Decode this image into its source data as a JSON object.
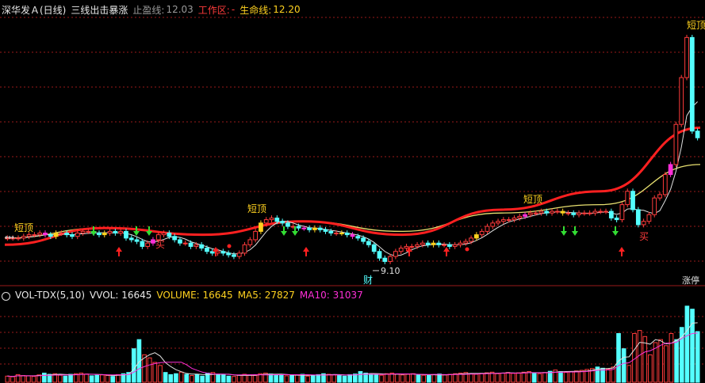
{
  "header": {
    "stock": "深华发Ａ(日线)",
    "indicator": "三线出击暴涨",
    "stop_label": "止盈线:",
    "stop_value": "12.03",
    "work_label": "工作区:",
    "work_value": "-",
    "life_label": "生命线:",
    "life_value": "12.20"
  },
  "vol_header": {
    "name": "VOL-TDX(5,10)",
    "vvol": "VVOL: 16645",
    "volume": "VOLUME: 16645",
    "ma5": "MA5: 27827",
    "ma10": "MA10: 31037"
  },
  "colors": {
    "up": "#ff3b3b",
    "down": "#54ffff",
    "red_line": "#ff2020",
    "yellow_line": "#e8e070",
    "white_line": "#e0e0e0",
    "yellow_candle": "#ffd21f",
    "magenta_candle": "#ff2fd8",
    "green_arrow": "#33dd33",
    "red_arrow": "#ff2020",
    "grid": "#9a1a1a",
    "short_top_label": "#ffd21f",
    "cai_label": "#54ffff",
    "mai_label": "#ff3b3b"
  },
  "chart_data": {
    "type": "candlestick",
    "y_range_price": [
      7.6,
      15.6
    ],
    "price_series_close": [
      9.0,
      9.0,
      9.0,
      9.05,
      9.1,
      9.1,
      9.15,
      9.1,
      9.05,
      9.15,
      9.15,
      9.1,
      9.05,
      9.15,
      9.2,
      9.2,
      9.15,
      9.1,
      9.15,
      9.2,
      9.15,
      9.2,
      9.0,
      8.95,
      8.9,
      8.75,
      8.85,
      8.95,
      9.1,
      9.15,
      9.05,
      8.95,
      8.85,
      8.85,
      8.75,
      8.8,
      8.7,
      8.6,
      8.55,
      8.6,
      8.55,
      8.5,
      8.45,
      8.55,
      8.8,
      8.95,
      9.2,
      9.45,
      9.55,
      9.6,
      9.5,
      9.45,
      9.35,
      9.35,
      9.3,
      9.3,
      9.25,
      9.3,
      9.25,
      9.2,
      9.15,
      9.15,
      9.15,
      9.1,
      9.05,
      9.0,
      8.9,
      8.8,
      8.6,
      8.4,
      8.3,
      8.45,
      8.6,
      8.7,
      8.75,
      8.75,
      8.8,
      8.85,
      8.8,
      8.85,
      8.8,
      8.8,
      8.75,
      8.8,
      8.85,
      8.9,
      9.0,
      9.1,
      9.2,
      9.35,
      9.45,
      9.5,
      9.55,
      9.55,
      9.6,
      9.65,
      9.7,
      9.75,
      9.75,
      9.8,
      9.75,
      9.8,
      9.8,
      9.75,
      9.75,
      9.7,
      9.75,
      9.75,
      9.75,
      9.8,
      9.8,
      9.8,
      9.6,
      9.55,
      10.0,
      10.4,
      9.85,
      9.4,
      9.5,
      9.7,
      10.2,
      10.3,
      10.9,
      11.2,
      12.4,
      13.8,
      15.0,
      12.2,
      12.0
    ],
    "red_line_y": [
      8.8,
      9.3,
      9.1,
      9.5,
      9.1,
      9.85,
      10.4,
      12.3
    ],
    "yellow_line_y": [
      9.0,
      9.3,
      9.1,
      9.5,
      9.2,
      9.75,
      10.0,
      11.2
    ],
    "signals": {
      "short_top": "短顶",
      "cai": "财",
      "mai": "买",
      "low_label": "9.10",
      "corner": "涨停"
    },
    "volume": [
      2000,
      1800,
      2500,
      2200,
      2100,
      1900,
      2400,
      3000,
      2600,
      2800,
      2300,
      2000,
      2600,
      2800,
      3000,
      2700,
      2100,
      2300,
      2400,
      2200,
      1900,
      2500,
      2800,
      3200,
      11000,
      14000,
      9000,
      8000,
      6500,
      5500,
      3200,
      2500,
      2800,
      3300,
      2600,
      2200,
      2500,
      2000,
      3000,
      3200,
      2600,
      2400,
      2000,
      1900,
      2300,
      2600,
      2400,
      2200,
      2800,
      3000,
      2700,
      2500,
      2300,
      2100,
      2200,
      2400,
      2600,
      2000,
      2300,
      2500,
      2800,
      2600,
      2400,
      2200,
      2000,
      2500,
      2700,
      3500,
      3000,
      2600,
      2400,
      2300,
      2800,
      3000,
      2700,
      2400,
      2600,
      2800,
      2400,
      2300,
      2200,
      2500,
      2700,
      2400,
      2600,
      2800,
      3000,
      3200,
      2800,
      2600,
      2900,
      3100,
      3300,
      2800,
      3000,
      3200,
      2900,
      3100,
      3300,
      3500,
      3000,
      2800,
      3200,
      3600,
      4000,
      3500,
      3200,
      3400,
      3700,
      3900,
      4200,
      4500,
      5000,
      4600,
      4300,
      5000,
      16000,
      11000,
      5500,
      16000,
      17000,
      15000,
      9000,
      13000,
      14000,
      12000,
      16000,
      14000,
      18000,
      25000,
      24000,
      16645
    ],
    "vol_ma5_range": [
      0,
      28000
    ]
  }
}
